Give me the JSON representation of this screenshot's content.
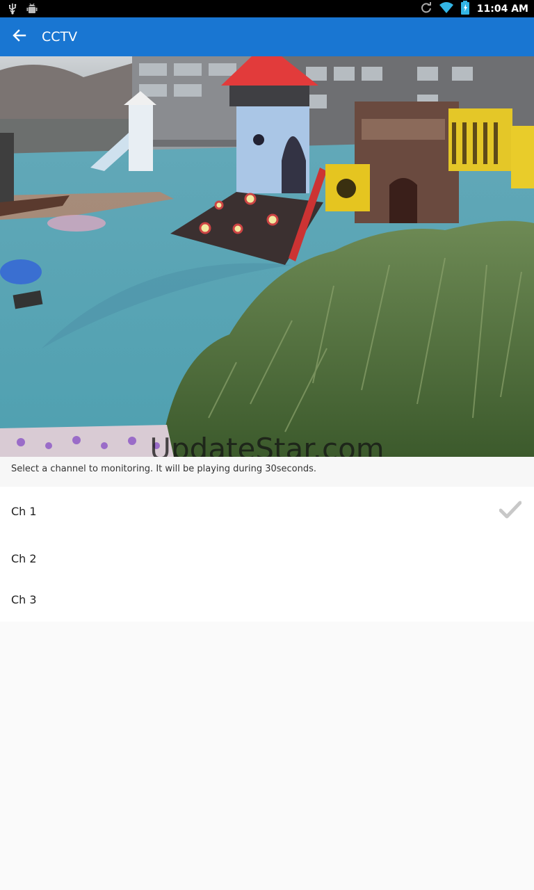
{
  "status": {
    "time": "11:04 AM",
    "icons": [
      "usb-icon",
      "android-debug-icon",
      "sync-icon",
      "wifi-icon",
      "battery-icon"
    ]
  },
  "app_bar": {
    "title": "CCTV",
    "back_icon": "arrow-back-icon",
    "color": "#1976d2"
  },
  "video": {
    "watermark": "UpdateStar.com"
  },
  "info_text": "Select a channel to monitoring. It will be playing during 30seconds.",
  "channels": [
    {
      "label": "Ch 1",
      "selected": true
    },
    {
      "label": "Ch 2",
      "selected": false
    },
    {
      "label": "Ch 3",
      "selected": false
    }
  ]
}
